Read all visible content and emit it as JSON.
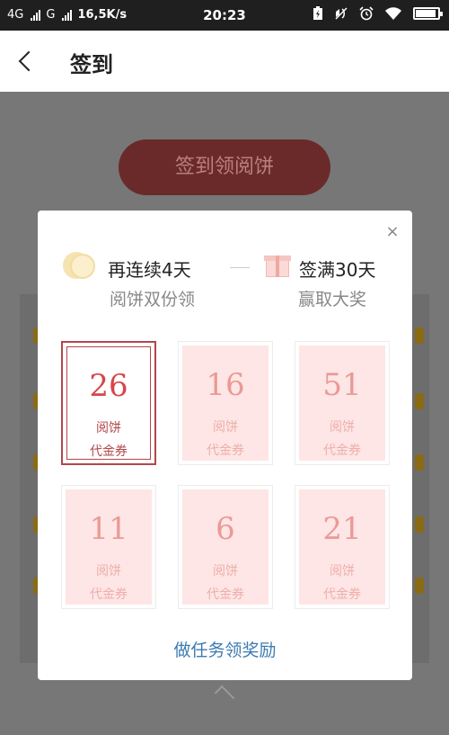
{
  "status_bar": {
    "network1": "4G",
    "network2": "G",
    "speed": "16,5K/s",
    "time": "20:23",
    "icons": [
      "battery-saver-icon",
      "mute-icon",
      "alarm-icon",
      "wifi-icon",
      "battery-icon"
    ]
  },
  "header": {
    "title": "签到"
  },
  "background": {
    "sign_button": "签到领阅饼"
  },
  "modal": {
    "streak": {
      "label": "再连续4天",
      "sub": "阅饼双份领"
    },
    "full": {
      "label": "签满30天",
      "sub": "赢取大奖"
    },
    "close_symbol": "×",
    "coupons": [
      {
        "amount": "26",
        "name1": "阅饼",
        "name2": "代金券",
        "selected": true
      },
      {
        "amount": "16",
        "name1": "阅饼",
        "name2": "代金券",
        "selected": false
      },
      {
        "amount": "51",
        "name1": "阅饼",
        "name2": "代金券",
        "selected": false
      },
      {
        "amount": "11",
        "name1": "阅饼",
        "name2": "代金券",
        "selected": false
      },
      {
        "amount": "6",
        "name1": "阅饼",
        "name2": "代金券",
        "selected": false
      },
      {
        "amount": "21",
        "name1": "阅饼",
        "name2": "代金券",
        "selected": false
      }
    ],
    "task_link": "做任务领奖励"
  },
  "colors": {
    "accent": "#b3464a",
    "link": "#3d7bb0",
    "coupon_bg": "#fde6e5"
  }
}
